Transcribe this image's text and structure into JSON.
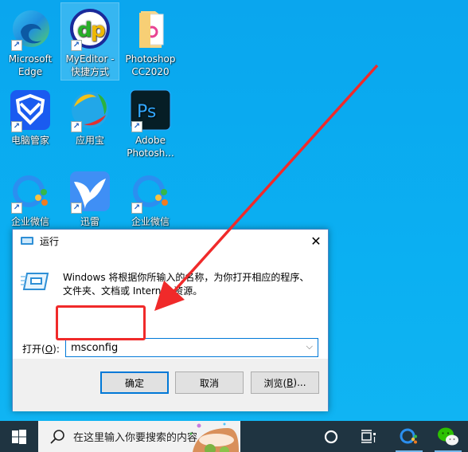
{
  "desktop": {
    "icons": [
      {
        "label": "Microsoft Edge",
        "icon": "edge-icon",
        "shortcut": true
      },
      {
        "label": "MyEditor - 快捷方式",
        "icon": "myeditor-icon",
        "shortcut": true,
        "selected": true
      },
      {
        "label": "Photoshop CC2020",
        "icon": "folder-icon",
        "shortcut": false
      },
      {
        "label": "电脑管家",
        "icon": "tencent-pc-manager-icon",
        "shortcut": true
      },
      {
        "label": "应用宝",
        "icon": "app-store-icon",
        "shortcut": true
      },
      {
        "label": "Adobe Photosh...",
        "icon": "photoshop-icon",
        "shortcut": true
      },
      {
        "label": "企业微信",
        "icon": "wecom-icon",
        "shortcut": true
      },
      {
        "label": "迅雷",
        "icon": "thunder-icon",
        "shortcut": true
      },
      {
        "label": "企业微信",
        "icon": "wecom-icon",
        "shortcut": true
      }
    ]
  },
  "run_dialog": {
    "title": "运行",
    "close_glyph": "✕",
    "description": "Windows 将根据你所输入的名称，为你打开相应的程序、文件夹、文档或 Internet 资源。",
    "open_label_prefix": "打开(",
    "open_label_key": "O",
    "open_label_suffix": "):",
    "input_value": "msconfig",
    "chevron_glyph": "⌵",
    "buttons": {
      "ok": "确定",
      "cancel": "取消",
      "browse_prefix": "浏览(",
      "browse_key": "B",
      "browse_suffix": ")..."
    }
  },
  "annotation": {
    "color": "#f02a2a"
  },
  "taskbar": {
    "search_placeholder": "在这里输入你要搜索的内容",
    "items": [
      "cortana-icon",
      "task-view-icon",
      "wecom-taskbar-icon",
      "wechat-taskbar-icon"
    ]
  }
}
